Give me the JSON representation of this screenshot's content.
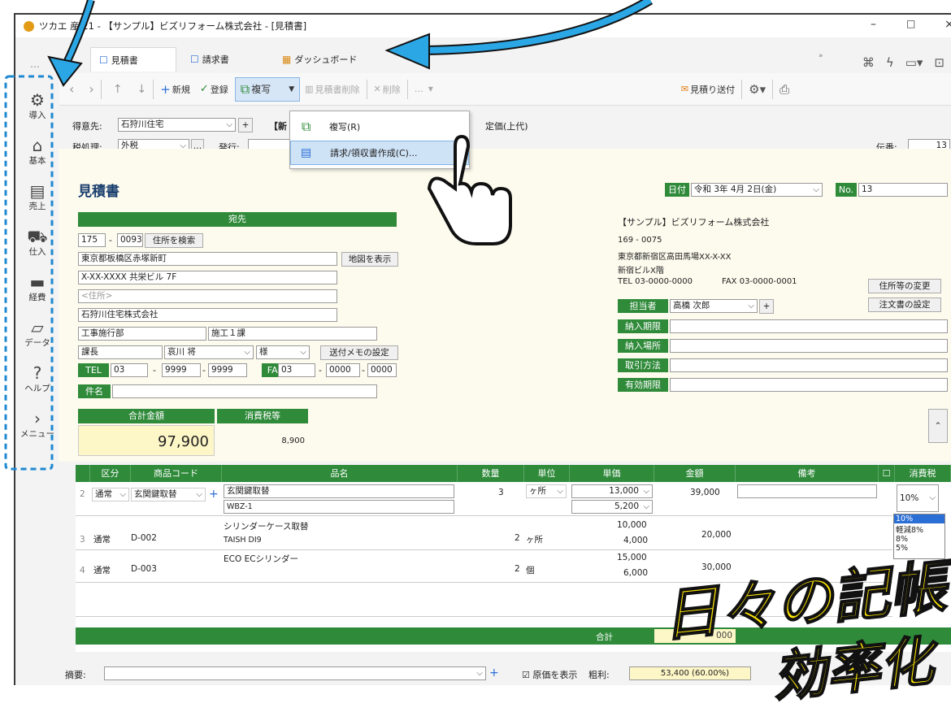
{
  "window": {
    "title": "ツカエ 産 21 - 【サンプル】ビズリフォーム株式会社 - [見積書]",
    "controls": [
      "–",
      "□",
      "×"
    ]
  },
  "tabs": [
    {
      "label": "見積書"
    },
    {
      "label": "請求書"
    },
    {
      "label": "ダッシュボード"
    }
  ],
  "more": "…",
  "toolbar": {
    "new": "新規",
    "register": "登録",
    "copy": "複写",
    "delete_quote": "見積書削除",
    "delete": "削除",
    "more": "…",
    "send": "見積り送付"
  },
  "sidebar": [
    {
      "label": "導入",
      "icon": "gear-icon"
    },
    {
      "label": "基本",
      "icon": "home-icon"
    },
    {
      "label": "売上",
      "icon": "register-icon"
    },
    {
      "label": "仕入",
      "icon": "cart-icon"
    },
    {
      "label": "経費",
      "icon": "card-icon"
    },
    {
      "label": "データ",
      "icon": "folder-icon"
    },
    {
      "label": "ヘルプ",
      "icon": "help-icon"
    },
    {
      "label": "メニュー",
      "icon": "chevron-right-icon"
    }
  ],
  "header": {
    "customer_label": "得意先:",
    "customer": "石狩川住宅",
    "new_label": "【新",
    "price_label": "定価(上代)",
    "tax_label": "税処理:",
    "tax": "外税",
    "issue_label": "発行:",
    "slip_label": "伝番:",
    "slip": "13"
  },
  "menu": {
    "copy": "複写(R)",
    "invoice": "請求/領収書作成(C)..."
  },
  "form": {
    "title": "見積書",
    "date_label": "日付",
    "date": "令和 3年 4月 2日(金)",
    "no_label": "No.",
    "no": "13",
    "recipient_label": "宛先",
    "zip1": "175",
    "zip2": "0093",
    "search_addr": "住所を検索",
    "addr1": "東京都板橋区赤塚新町",
    "map": "地図を表示",
    "addr2": "X-XX-XXXX 共栄ビル 7F",
    "addr3_ph": "<住所>",
    "company": "石狩川住宅株式会社",
    "dept": "工事施行部",
    "section": "施工１課",
    "title_role": "課長",
    "person": "哀川 将",
    "honorific": "様",
    "memo_btn": "送付メモの設定",
    "tel_label": "TEL",
    "tel": [
      "03",
      "9999",
      "9999"
    ],
    "fax_label": "FAX",
    "fax": [
      "03",
      "0000",
      "0000"
    ],
    "subject_label": "件名",
    "total_label": "合計金額",
    "tax_total_label": "消費税等",
    "total": "97,900",
    "tax_total": "8,900",
    "company_name": "【サンプル】ビズリフォーム株式会社",
    "company_zip": "169 - 0075",
    "company_addr": "東京都新宿区高田馬場XX-X-XX",
    "company_bldg": "新宿ビルX階",
    "company_tel": "TEL 03-0000-0000",
    "company_fax": "FAX 03-0000-0001",
    "change_addr": "住所等の変更",
    "order_settings": "注文書の設定",
    "staff_label": "担当者",
    "staff": "高橋 次郎",
    "due_label": "納入期限",
    "place_label": "納入場所",
    "terms_label": "取引方法",
    "valid_label": "有効期限"
  },
  "grid": {
    "headers": [
      "区分",
      "商品コード",
      "品名",
      "数量",
      "単位",
      "単価",
      "金額",
      "備考",
      "消費税"
    ],
    "rows": [
      {
        "no": "2",
        "kind": "通常",
        "code": "玄関鍵取替",
        "name": "玄関鍵取替",
        "sub": "WBZ-1",
        "qty": "3",
        "unit": "ヶ所",
        "price": "13,000",
        "cost": "5,200",
        "amount": "39,000",
        "tax": "10%"
      },
      {
        "no": "3",
        "kind": "通常",
        "code": "D-002",
        "name": "シリンダーケース取替",
        "sub": "TAISH DI9",
        "qty": "2",
        "unit": "ヶ所",
        "price": "10,000",
        "cost": "4,000",
        "amount": "20,000"
      },
      {
        "no": "4",
        "kind": "通常",
        "code": "D-003",
        "name": "ECO ECシリンダー",
        "sub": "",
        "qty": "2",
        "unit": "個",
        "price": "15,000",
        "cost": "6,000",
        "amount": "30,000"
      }
    ],
    "tax_options": [
      "10%",
      "軽減8%",
      "8%",
      "5%"
    ],
    "total_label": "合計",
    "total_partial": "000"
  },
  "footer": {
    "summary_label": "摘要:",
    "show_cost": "原価を表示",
    "gross_label": "粗利:",
    "gross": "53,400 (60.00%)"
  },
  "callout": {
    "line1": "日々の記帳",
    "line2": "効率化"
  },
  "colors": {
    "green": "#2f8a3a",
    "accent_blue": "#1e88d0",
    "callout_yellow": "#ffe600"
  }
}
